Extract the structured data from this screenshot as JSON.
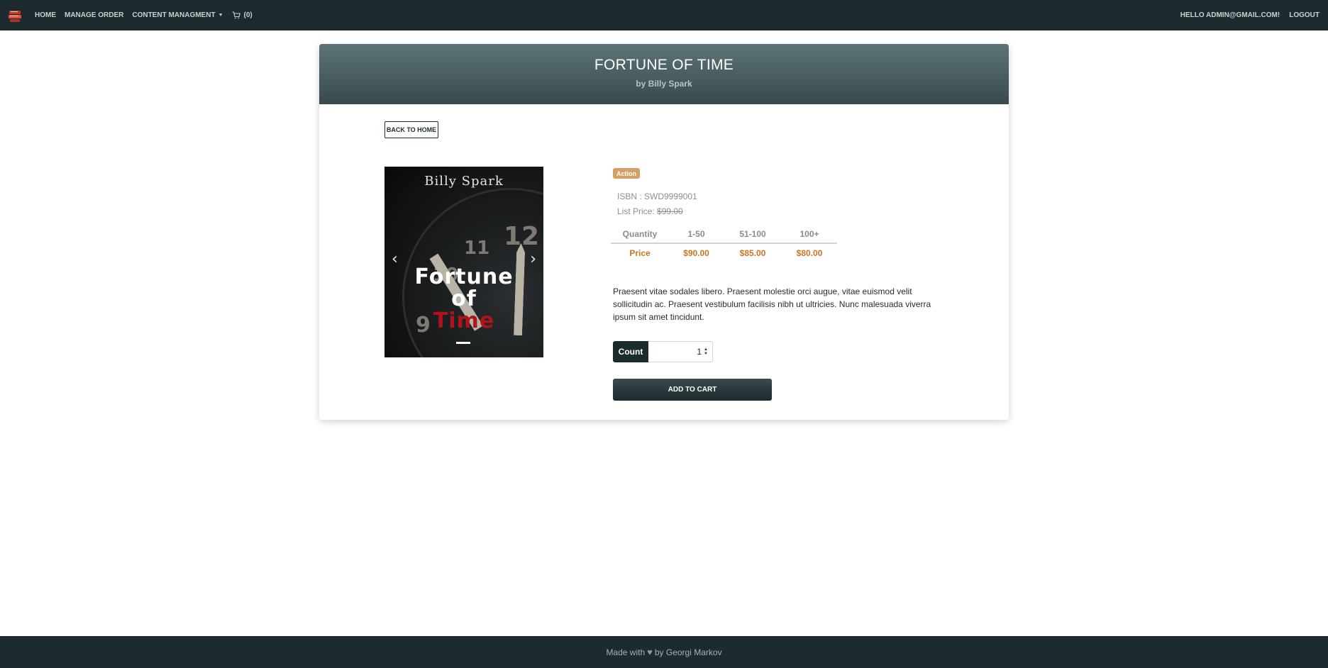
{
  "nav": {
    "brand_icon": "book-stack-icon",
    "home": "HOME",
    "manage_order": "MANAGE ORDER",
    "content_management": "CONTENT MANAGMENT",
    "cart_icon": "cart-icon",
    "cart_count": "(0)",
    "greeting": "HELLO ADMIN@GMAIL.COM!",
    "logout": "LOGOUT"
  },
  "book": {
    "title": "FORTUNE OF TIME",
    "by_author": "by Billy Spark",
    "back_label": "BACK TO HOME",
    "cover": {
      "author": "Billy Spark",
      "title_line1": "Fortune",
      "title_line2": "of",
      "title_line3": "Time",
      "clock_numbers": [
        "12",
        "11",
        "10",
        "9"
      ]
    },
    "category": "Action",
    "isbn": "ISBN : SWD9999001",
    "list_price_label": "List Price:",
    "list_price": "$99.00",
    "price_table": {
      "header": [
        "Quantity",
        "1-50",
        "51-100",
        "100+"
      ],
      "row": [
        "Price",
        "$90.00",
        "$85.00",
        "$80.00"
      ]
    },
    "description": "Praesent vitae sodales libero. Praesent molestie orci augue, vitae euismod velit sollicitudin ac. Praesent vestibulum facilisis nibh ut ultricies. Nunc malesuada viverra ipsum sit amet tincidunt.",
    "count_label": "Count",
    "count_value": "1",
    "add_to_cart": "ADD TO CART"
  },
  "footer": {
    "made_with": "Made with",
    "by": "by Georgi Markov"
  },
  "colors": {
    "navbar": "#1c2b2d",
    "accent_price": "#c8751f",
    "badge": "#d4a066"
  }
}
